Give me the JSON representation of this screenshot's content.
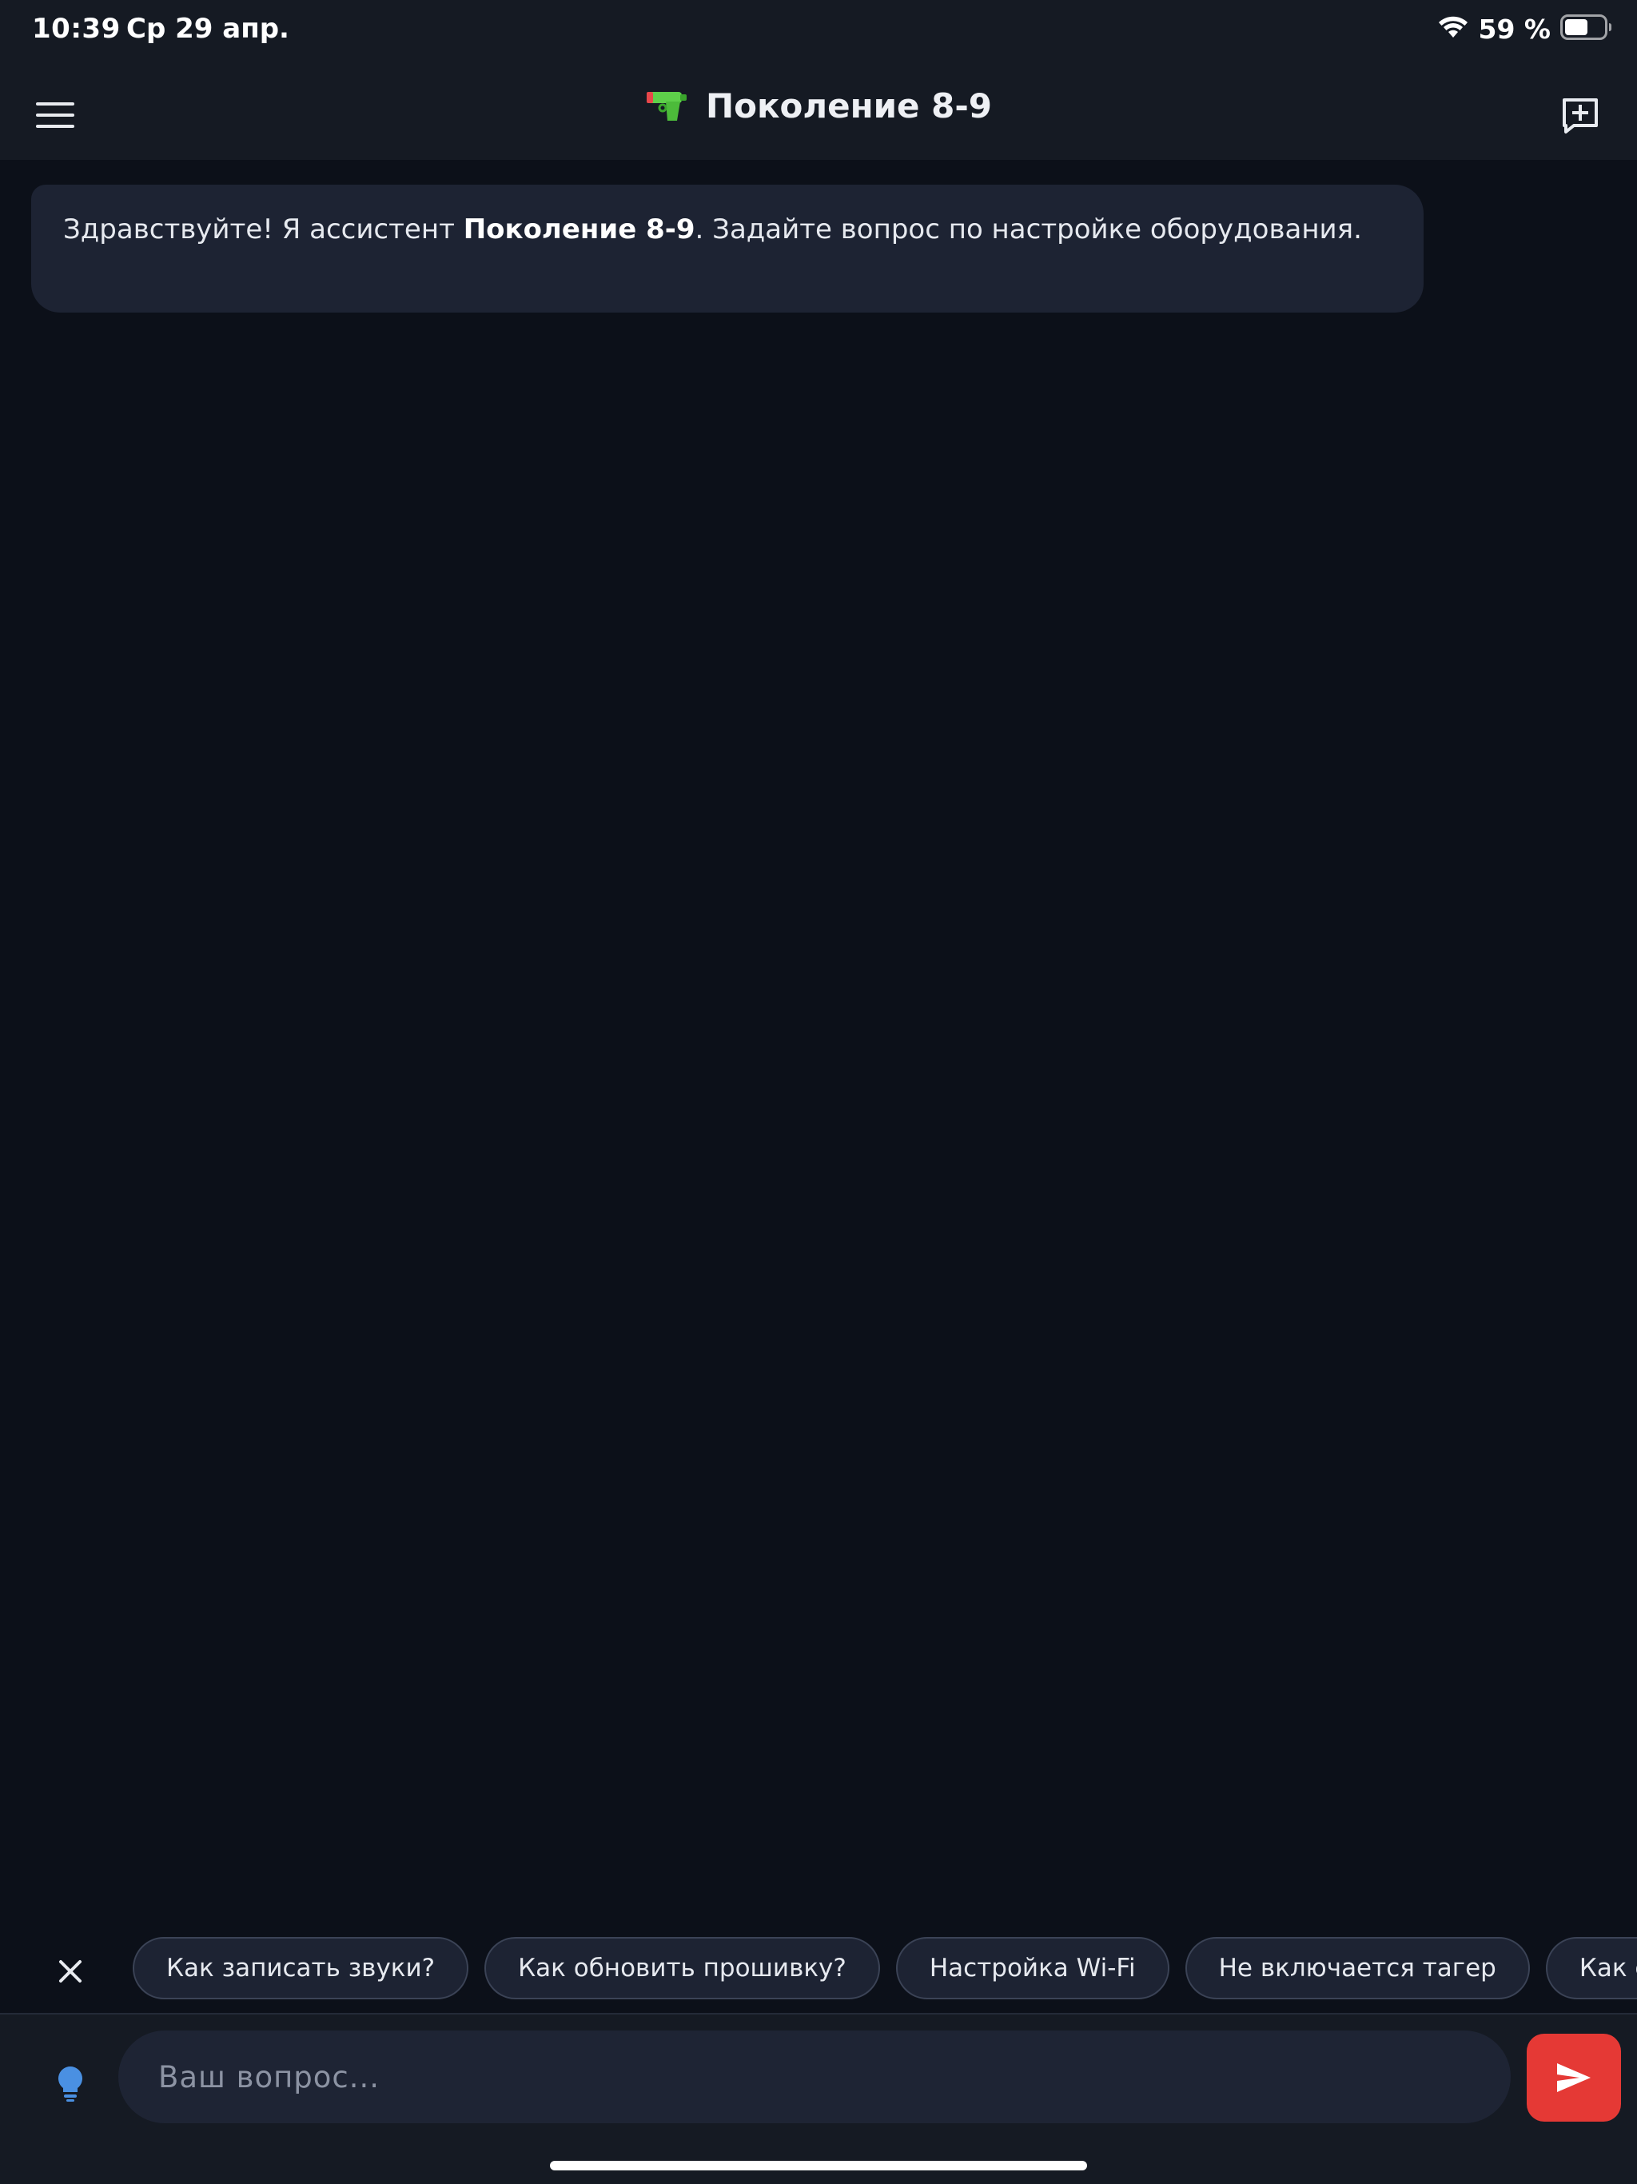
{
  "status_bar": {
    "time": "10:39",
    "date": "Ср 29 апр.",
    "battery_percent": "59 %",
    "battery_level": 0.59
  },
  "header": {
    "title": "Поколение 8-9",
    "logo_icon": "water-pistol-icon"
  },
  "chat": {
    "messages": [
      {
        "role": "assistant",
        "text_before": "Здравствуйте! Я ассистент ",
        "text_bold": "Поколение 8-9",
        "text_after": ". Задайте вопрос по настройке оборудования."
      }
    ]
  },
  "suggestions": {
    "items": [
      "Как записать звуки?",
      "Как обновить прошивку?",
      "Настройка Wi-Fi",
      "Не включается тагер",
      "Как сме"
    ]
  },
  "input": {
    "placeholder": "Ваш вопрос..."
  },
  "colors": {
    "background": "#0c1019",
    "bar": "#151a23",
    "bubble": "#1d2333",
    "send": "#e53935",
    "hint": "#4a90e2"
  }
}
